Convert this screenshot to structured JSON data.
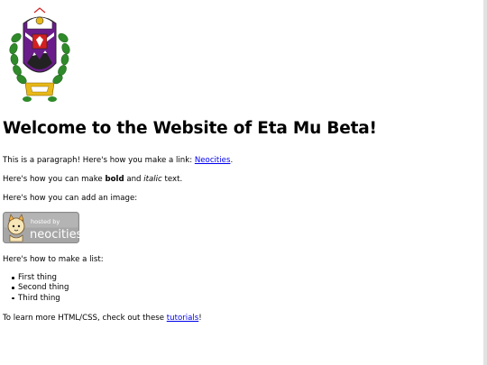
{
  "heading": "Welcome to the Website of Eta Mu Beta!",
  "paragraph1": {
    "before": "This is a paragraph! Here's how you make a link: ",
    "link": "Neocities",
    "after": "."
  },
  "paragraph2": {
    "before": "Here's how you can make ",
    "bold": "bold",
    "middle": " and ",
    "italic": "italic",
    "after": " text."
  },
  "paragraph3": "Here's how you can add an image:",
  "badge": {
    "line1": "hosted by",
    "line2": "neocities",
    "icon": "neocities-cat-icon"
  },
  "paragraph4": "Here's how to make a list:",
  "list": [
    "First thing",
    "Second thing",
    "Third thing"
  ],
  "paragraph5": {
    "before": "To learn more HTML/CSS, check out these ",
    "link": "tutorials",
    "after": "!"
  },
  "colors": {
    "link": "#0000ee",
    "badge_bg": "#a6a6a6",
    "crest_purple": "#6a1d8a",
    "crest_green": "#2f8a2a",
    "crest_red": "#d42020",
    "crest_gold": "#e8b818"
  }
}
